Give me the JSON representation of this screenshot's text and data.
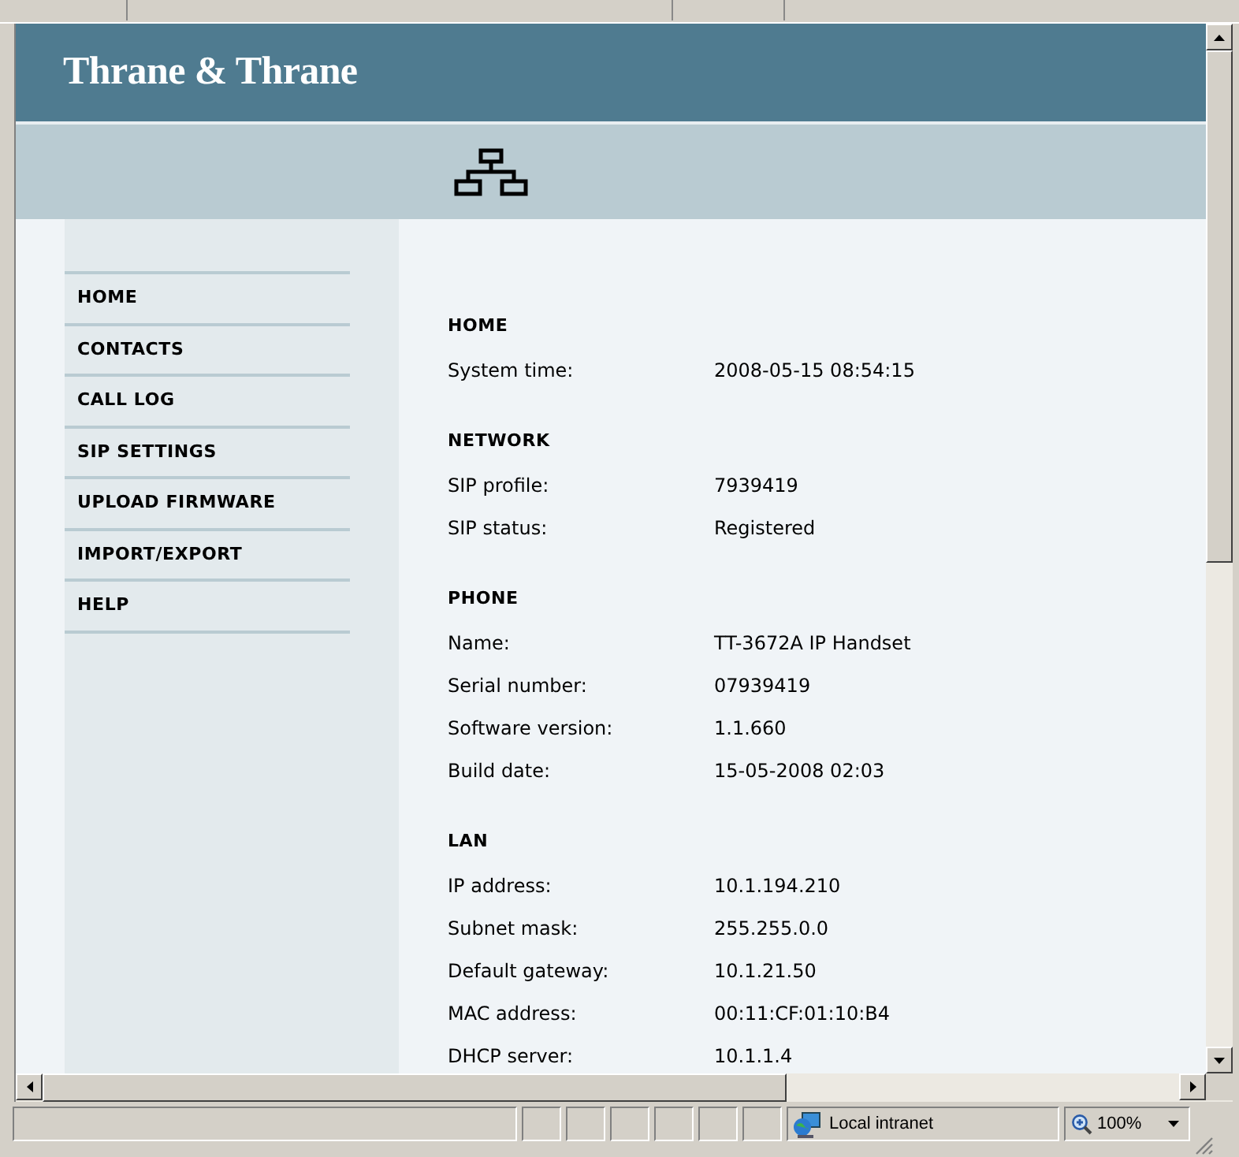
{
  "header": {
    "logo": "Thrane & Thrane"
  },
  "sidebar": {
    "items": [
      {
        "label": "HOME"
      },
      {
        "label": "CONTACTS"
      },
      {
        "label": "CALL LOG"
      },
      {
        "label": "SIP SETTINGS"
      },
      {
        "label": "UPLOAD FIRMWARE"
      },
      {
        "label": "IMPORT/EXPORT"
      },
      {
        "label": "HELP"
      }
    ]
  },
  "sections": [
    {
      "title": "HOME",
      "rows": [
        {
          "label": "System time:",
          "value": "2008-05-15 08:54:15"
        }
      ]
    },
    {
      "title": "NETWORK",
      "rows": [
        {
          "label": "SIP profile:",
          "value": "7939419"
        },
        {
          "label": "SIP status:",
          "value": "Registered"
        }
      ]
    },
    {
      "title": "PHONE",
      "rows": [
        {
          "label": "Name:",
          "value": "TT-3672A IP Handset"
        },
        {
          "label": "Serial number:",
          "value": "07939419"
        },
        {
          "label": "Software version:",
          "value": "1.1.660"
        },
        {
          "label": "Build date:",
          "value": "15-05-2008 02:03"
        }
      ]
    },
    {
      "title": "LAN",
      "rows": [
        {
          "label": "IP address:",
          "value": "10.1.194.210"
        },
        {
          "label": "Subnet mask:",
          "value": "255.255.0.0"
        },
        {
          "label": "Default gateway:",
          "value": "10.1.21.50"
        },
        {
          "label": "MAC address:",
          "value": "00:11:CF:01:10:B4"
        },
        {
          "label": "DHCP server:",
          "value": "10.1.1.4"
        }
      ]
    }
  ],
  "status_bar": {
    "zone": "Local intranet",
    "zoom": "100%"
  }
}
